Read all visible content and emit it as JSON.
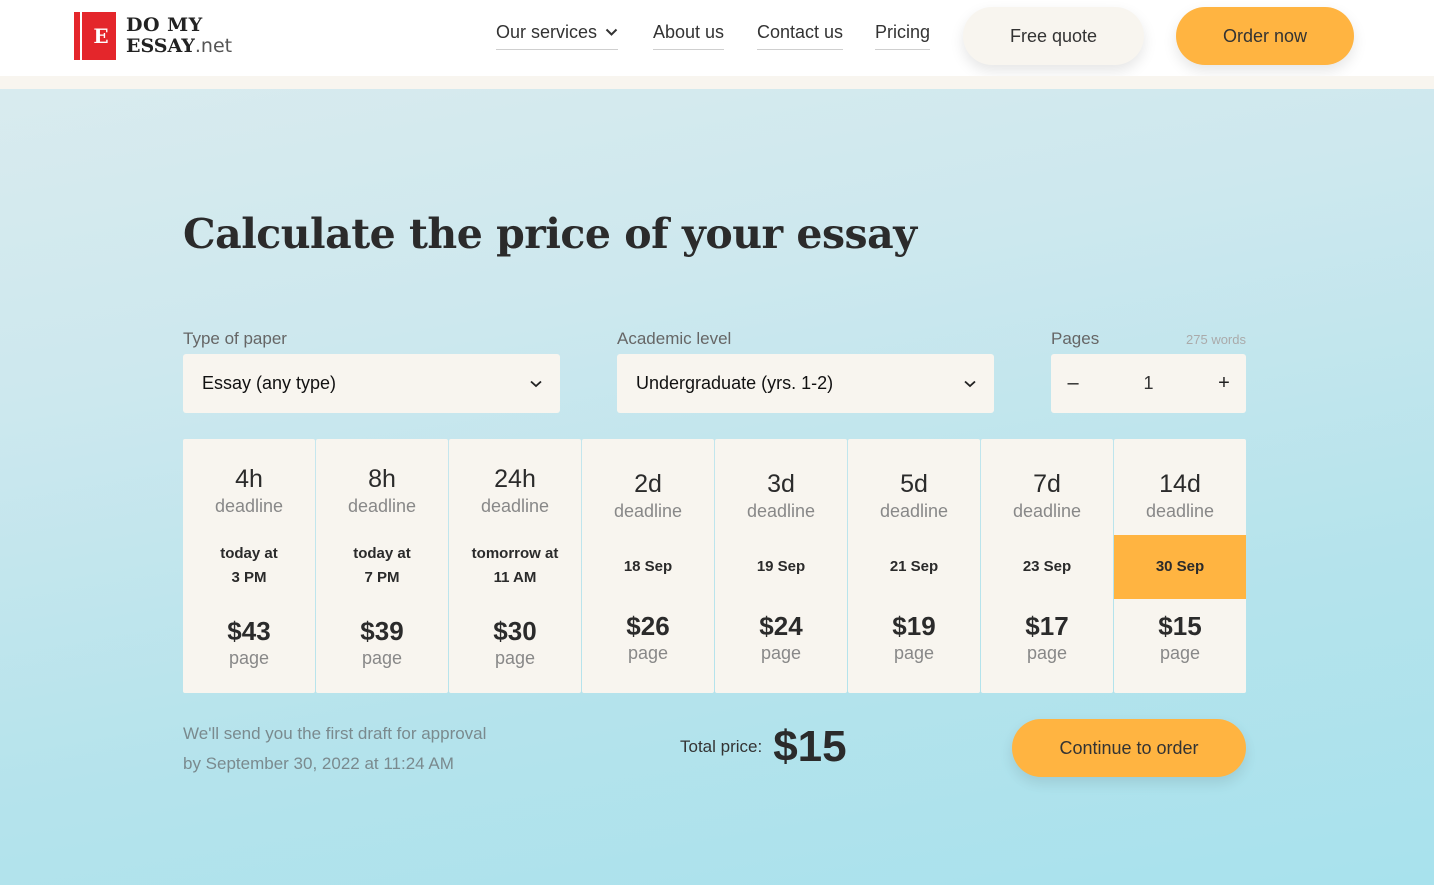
{
  "brand": {
    "logo_letter": "E",
    "line1": "DO MY",
    "line2_bold": "ESSAY",
    "line2_suffix": ".net"
  },
  "nav": {
    "services": "Our services",
    "about": "About us",
    "contact": "Contact us",
    "pricing": "Pricing",
    "free_quote": "Free quote",
    "order_now": "Order now"
  },
  "calculator": {
    "title": "Calculate the price of your essay",
    "paper_label": "Type of paper",
    "paper_value": "Essay (any type)",
    "level_label": "Academic level",
    "level_value": "Undergraduate (yrs. 1-2)",
    "pages_label": "Pages",
    "words_note": "275 words",
    "pages_value": "1",
    "minus": "–",
    "plus": "+",
    "deadlines": [
      {
        "time": "4h",
        "label": "deadline",
        "date_line1": "today at",
        "date_line2": "3 PM",
        "price": "$43",
        "unit": "page"
      },
      {
        "time": "8h",
        "label": "deadline",
        "date_line1": "today at",
        "date_line2": "7 PM",
        "price": "$39",
        "unit": "page"
      },
      {
        "time": "24h",
        "label": "deadline",
        "date_line1": "tomorrow at",
        "date_line2": "11 AM",
        "price": "$30",
        "unit": "page"
      },
      {
        "time": "2d",
        "label": "deadline",
        "date": "18 Sep",
        "price": "$26",
        "unit": "page"
      },
      {
        "time": "3d",
        "label": "deadline",
        "date": "19 Sep",
        "price": "$24",
        "unit": "page"
      },
      {
        "time": "5d",
        "label": "deadline",
        "date": "21 Sep",
        "price": "$19",
        "unit": "page"
      },
      {
        "time": "7d",
        "label": "deadline",
        "date": "23 Sep",
        "price": "$17",
        "unit": "page"
      },
      {
        "time": "14d",
        "label": "deadline",
        "date": "30 Sep",
        "price": "$15",
        "unit": "page",
        "selected": true
      }
    ],
    "draft_line1": "We'll send you the first draft for approval",
    "draft_line2": "by September 30, 2022 at 11:24 AM",
    "total_label": "Total price:",
    "total_value": "$15",
    "continue": "Continue to order"
  },
  "colors": {
    "accent": "#ffb441",
    "brand_red": "#e4262b",
    "card_bg": "#f8f5ef"
  }
}
